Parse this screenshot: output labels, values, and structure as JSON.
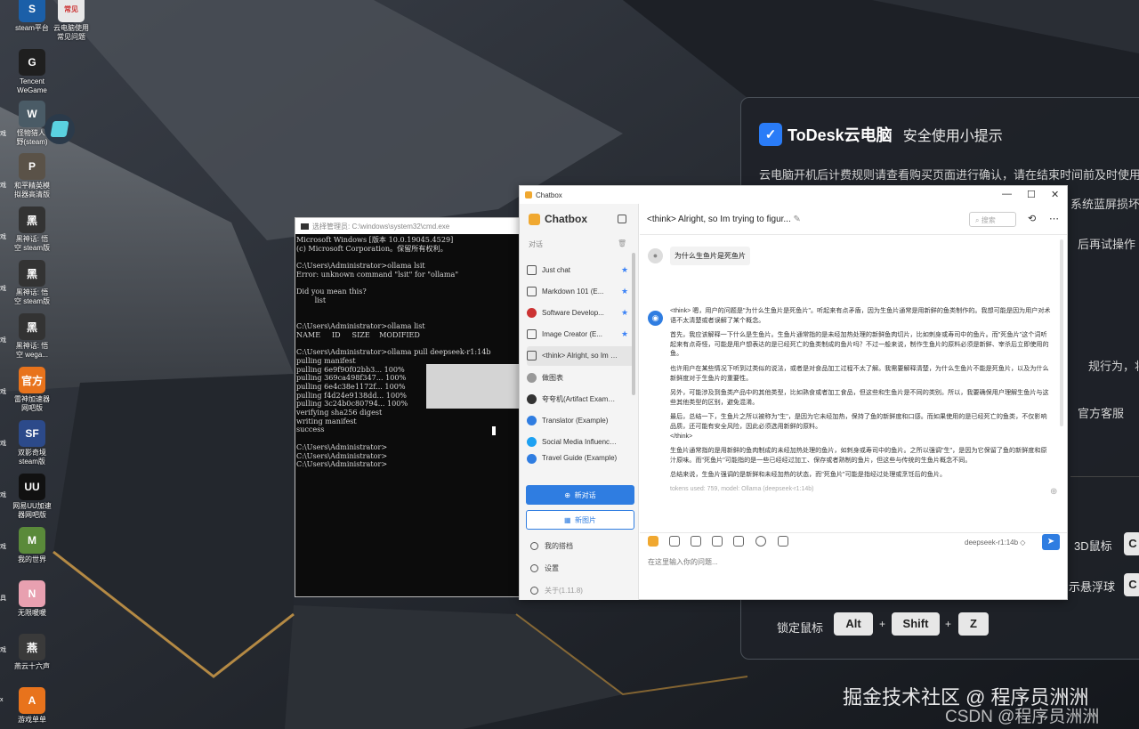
{
  "desktop": {
    "icons": [
      {
        "label": "steam平台",
        "glyph": "S",
        "color": "#1b5fa8"
      },
      {
        "label": "云电脑使用\n常见问题",
        "glyph": "常见",
        "color": "#e8e8e8"
      },
      {
        "label": "Tencent\nWeGame",
        "glyph": "G",
        "color": "#1f1f1f"
      },
      {
        "label": "怪物猎人:\n野(steam)",
        "glyph": "W",
        "color": "#4a5b66"
      },
      {
        "label": "和平精英模\n拟器高清版",
        "glyph": "P",
        "color": "#5a5248"
      },
      {
        "label": "黑神话: 悟\n空 steam版",
        "glyph": "黑",
        "color": "#333"
      },
      {
        "label": "黑神话: 悟\n空 steam版",
        "glyph": "黑",
        "color": "#333"
      },
      {
        "label": "黑神话: 悟\n空 wega...",
        "glyph": "黑",
        "color": "#333"
      },
      {
        "label": "雷神加速器\n网吧版",
        "glyph": "官方",
        "color": "#e8731c"
      },
      {
        "label": "双影奇境\nsteam版",
        "glyph": "SF",
        "color": "#2c4a8a"
      },
      {
        "label": "网易UU加速\n器网吧版",
        "glyph": "UU",
        "color": "#111"
      },
      {
        "label": "我的世界",
        "glyph": "M",
        "color": "#5a8a3a"
      },
      {
        "label": "无限暖暖",
        "glyph": "N",
        "color": "#e8a0b0"
      },
      {
        "label": "燕云十六声",
        "glyph": "燕",
        "color": "#3a3a3a"
      },
      {
        "label": "游戏单单",
        "glyph": "A",
        "color": "#e8731c"
      }
    ],
    "left_strip": [
      "戏",
      "戏",
      "戏",
      "戏",
      "戏",
      "戏",
      "戏",
      "戏",
      "戏",
      "具",
      "戏",
      "x",
      "fi"
    ]
  },
  "todesk": {
    "brand": "ToDesk云电脑",
    "subtitle": "安全使用小提示",
    "lines": [
      "云电脑开机后计费规则请查看购买页面进行确认，请在结束时间前及时使用",
      "系统蓝屏损坏",
      "后再试操作",
      "规行为，将",
      "官方客服"
    ],
    "hotkeys": {
      "mouse_3d": "3D鼠标",
      "float": "示悬浮球",
      "lock_label": "锁定鼠标",
      "keys": [
        "Alt",
        "Shift",
        "Z"
      ],
      "plus": "+",
      "partial_key": "C"
    }
  },
  "cmd": {
    "title": "选择管理员: C:\\windows\\system32\\cmd.exe",
    "lines": [
      "Microsoft Windows [版本 10.0.19045.4529]",
      "(c) Microsoft Corporation。保留所有权利。",
      "",
      "C:\\Users\\Administrator>ollama lsit",
      "Error: unknown command \"lsit\" for \"ollama\"",
      "",
      "Did you mean this?",
      "        list",
      "",
      "",
      "C:\\Users\\Administrator>ollama list",
      "NAME     ID     SIZE    MODIFIED",
      "",
      "C:\\Users\\Administrator>ollama pull deepseek-r1:14b",
      "pulling manifest",
      "pulling 6e9f90f02bb3... 100%",
      "pulling 369ca498f347... 100%",
      "pulling 6e4c38e1172f... 100%",
      "pulling f4d24e9138dd... 100%",
      "pulling 3c24b0c80794... 100%",
      "verifying sha256 digest",
      "writing manifest",
      "success",
      "",
      "C:\\Users\\Administrator>",
      "C:\\Users\\Administrator>",
      "C:\\Users\\Administrator>"
    ]
  },
  "chatbox": {
    "window_title": "Chatbox",
    "win_controls": {
      "minimize": "—",
      "maximize": "☐",
      "close": "✕"
    },
    "brand": "Chatbox",
    "section_label": "对话",
    "conversations": [
      {
        "title": "Just chat",
        "starred": true
      },
      {
        "title": "Markdown 101 (E...",
        "starred": true
      },
      {
        "title": "Software Develop...",
        "starred": true
      },
      {
        "title": "Image Creator (E...",
        "starred": true
      },
      {
        "title": "<think> Alright, so Im tr...",
        "starred": false,
        "active": true
      },
      {
        "title": "做图表",
        "starred": false
      },
      {
        "title": "夸夸机(Artifact Example)",
        "starred": false
      },
      {
        "title": "Translator (Example)",
        "starred": false
      },
      {
        "title": "Social Media Influence...",
        "starred": false
      },
      {
        "title": "Travel Guide (Example)",
        "starred": false
      }
    ],
    "new_chat": "新对话",
    "new_image": "新图片",
    "footer": {
      "partners": "我的搭档",
      "settings": "设置",
      "about": "关于(1.11.8)"
    },
    "header_title": "<think> Alright, so Im trying to figur...",
    "search_placeholder": "搜索",
    "user_message": "为什么生鱼片是死鱼片",
    "assistant_paragraphs": [
      "<think> 嗯，用户的问题是\"为什么生鱼片是死鱼片\"。听起来有点矛盾，因为生鱼片通常是用新鲜的鱼类制作的。我想可能是因为用户对术语不太清楚或者误解了某个概念。",
      "首先，我应该解释一下什么是生鱼片。生鱼片通常指的是未经加热处理的新鲜鱼肉切片，比如刺身或寿司中的鱼片。而\"死鱼片\"这个词听起来有点奇怪，可能是用户想表达的是已经死亡的鱼类制成的鱼片吗？不过一般来说，制作生鱼片的原料必须是新鲜、宰杀后立即使用的鱼。",
      "也许用户在某些情况下听到过类似的说法，或者是对食品加工过程不太了解。我需要解释清楚，为什么生鱼片不能是死鱼片，以及为什么新鲜度对于生鱼片的重要性。",
      "另外，可能涉及到鱼类产品中的其他类型，比如熟食或者加工食品，但这些和生鱼片是不同的类别。所以，我要确保用户理解生鱼片与这些其他类型的区别，避免混淆。",
      "最后，总结一下，生鱼片之所以被称为\"生\"，是因为它未经加热，保持了鱼的新鲜度和口感。而如果使用的是已经死亡的鱼类，不仅影响品质，还可能有安全风险，因此必须选用新鲜的原料。\n</think>",
      "生鱼片通常指的是用新鲜的鱼肉制成的未经加热处理的鱼片，如刺身或寿司中的鱼片。之所以强调\"生\"，是因为它保留了鱼的新鲜度和原汁原味。而\"死鱼片\"可能指的是一些已经经过加工、保存或者熟制的鱼片，但这些与传统的生鱼片概念不同。",
      "总结来说，生鱼片强调的是新鲜和未经加热的状态，而\"死鱼片\"可能是指经过处理或烹饪后的鱼片。"
    ],
    "meta": "tokens used: 759, model: Ollama (deepseek-r1:14b)",
    "model_selector": "deepseek-r1:14b ◇",
    "input_placeholder": "在这里输入你的问题...",
    "colors": {
      "accent": "#2f7de1",
      "star": "#3b82f6"
    }
  },
  "watermark": {
    "line1": "掘金技术社区 @ 程序员洲洲",
    "line2": "CSDN @程序员洲洲"
  }
}
